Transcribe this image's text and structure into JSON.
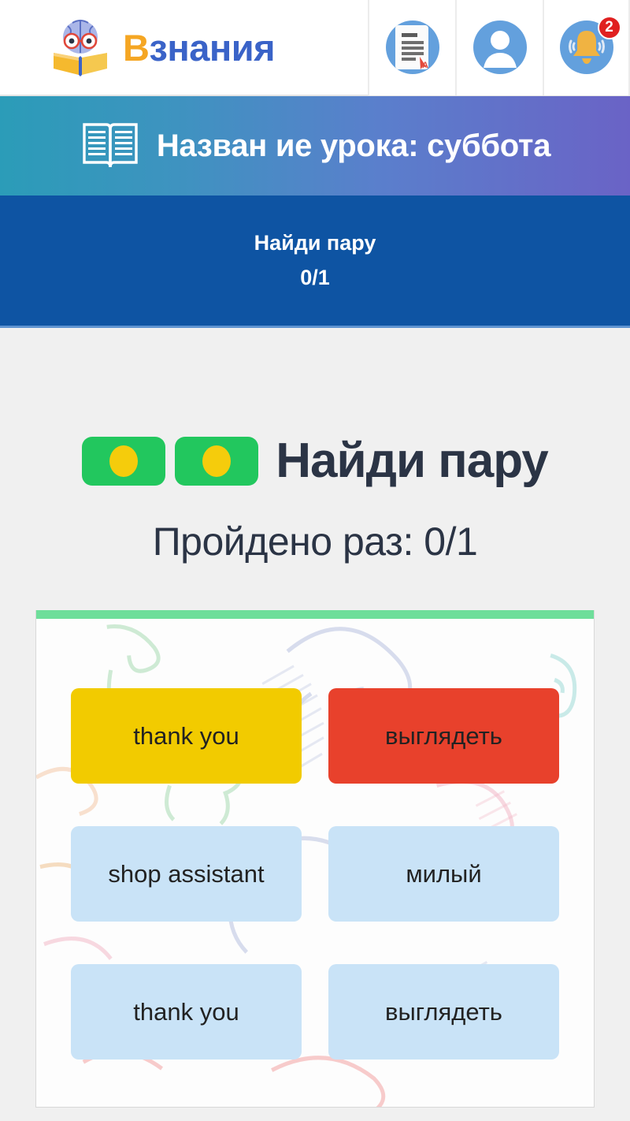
{
  "header": {
    "brand": {
      "logo_icon": "brain-book-icon",
      "text_first": "В",
      "text_rest": "знания",
      "full_text": "Взнания"
    },
    "actions": [
      {
        "name": "grades-document-button",
        "icon": "document-grade-icon",
        "label": ""
      },
      {
        "name": "profile-button",
        "icon": "user-profile-icon",
        "label": ""
      },
      {
        "name": "notifications-button",
        "icon": "bell-icon",
        "label": "",
        "badge": "2"
      }
    ],
    "colors": {
      "brand_orange": "#f5a623",
      "brand_blue": "#3a63c8",
      "icon_blue": "#63a0dd",
      "badge_red": "#e02020"
    }
  },
  "lesson_banner": {
    "icon": "open-book-icon",
    "title": "Назван ие урока: суббота",
    "gradient_from": "#2b9cb8",
    "gradient_to": "#6a63c6"
  },
  "task_bar": {
    "task_name": "Найди пару",
    "task_score": "0/1",
    "background": "#0e54a3"
  },
  "main": {
    "game_title": "Найди пару",
    "attempts_label": "Пройдено раз: 0/1",
    "chip_icon": "pair-chip-icon",
    "chip_color": "#22c75e",
    "chip_dot_color": "#f5cc0c",
    "card": {
      "top_border_color": "#6ede9a",
      "tiles": [
        {
          "text": "thank you",
          "style": "tile-yellow",
          "color": "#f2cb00"
        },
        {
          "text": "выглядеть",
          "style": "tile-red",
          "color": "#e8412c"
        },
        {
          "text": "shop assistant",
          "style": "tile-blue",
          "color": "#c9e3f7"
        },
        {
          "text": "милый",
          "style": "tile-blue",
          "color": "#c9e3f7"
        },
        {
          "text": "thank you",
          "style": "tile-blue",
          "color": "#c9e3f7"
        },
        {
          "text": "выглядеть",
          "style": "tile-blue",
          "color": "#c9e3f7"
        }
      ]
    }
  }
}
